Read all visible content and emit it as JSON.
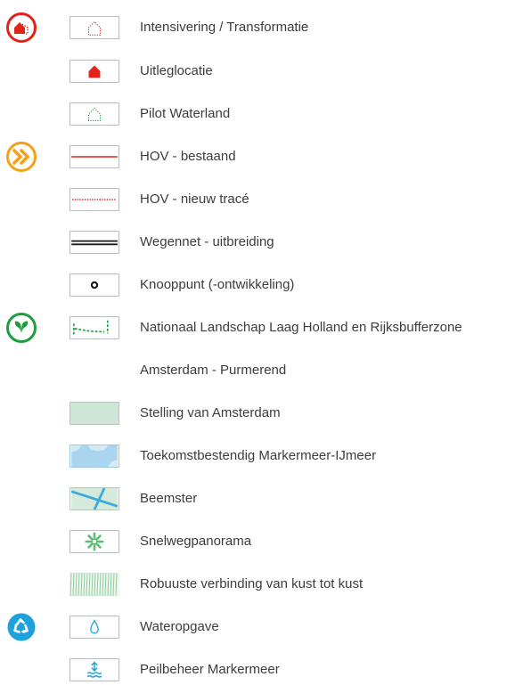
{
  "legend": {
    "items": [
      {
        "label": "Intensivering / Transformatie",
        "symbol": "house-dotted-red-icon",
        "category_icon": "house-category-icon"
      },
      {
        "label": "Uitleglocatie",
        "symbol": "house-filled-red-icon"
      },
      {
        "label": "Pilot Waterland",
        "symbol": "house-dotted-green-icon"
      },
      {
        "label": "HOV - bestaand",
        "symbol": "red-line-icon",
        "category_icon": "transport-category-icon"
      },
      {
        "label": "HOV - nieuw tracé",
        "symbol": "red-dotted-line-icon"
      },
      {
        "label": "Wegennet - uitbreiding",
        "symbol": "double-black-line-icon"
      },
      {
        "label": "Knooppunt (-ontwikkeling)",
        "symbol": "node-circle-icon"
      },
      {
        "label": "Nationaal Landschap Laag Holland en Rijksbufferzone",
        "symbol": "green-dashed-boundary-icon",
        "category_icon": "nature-category-icon"
      },
      {
        "label": "Amsterdam - Purmerend",
        "symbol": ""
      },
      {
        "label": "Stelling van Amsterdam",
        "symbol": "green-area-icon"
      },
      {
        "label": "Toekomstbestendig Markermeer-IJmeer",
        "symbol": "blue-water-area-icon"
      },
      {
        "label": "Beemster",
        "symbol": "beemster-grid-icon"
      },
      {
        "label": "Snelwegpanorama",
        "symbol": "green-asterisk-icon"
      },
      {
        "label": "Robuuste verbinding van kust tot kust",
        "symbol": "green-hatch-icon"
      },
      {
        "label": "Wateropgave",
        "symbol": "water-drop-icon",
        "category_icon": "water-category-icon"
      },
      {
        "label": "Peilbeheer Markermeer",
        "symbol": "water-level-icon"
      }
    ]
  },
  "colors": {
    "red": "#e2231a",
    "orange": "#f5a01a",
    "green": "#1f9e3d",
    "light_green": "#5cbf73",
    "blue": "#1ea2dc",
    "area_green": "#cfe5d6",
    "water_blue": "#a9d6ee",
    "text": "#3c3c3c",
    "swatch_border": "#b9bec3"
  }
}
